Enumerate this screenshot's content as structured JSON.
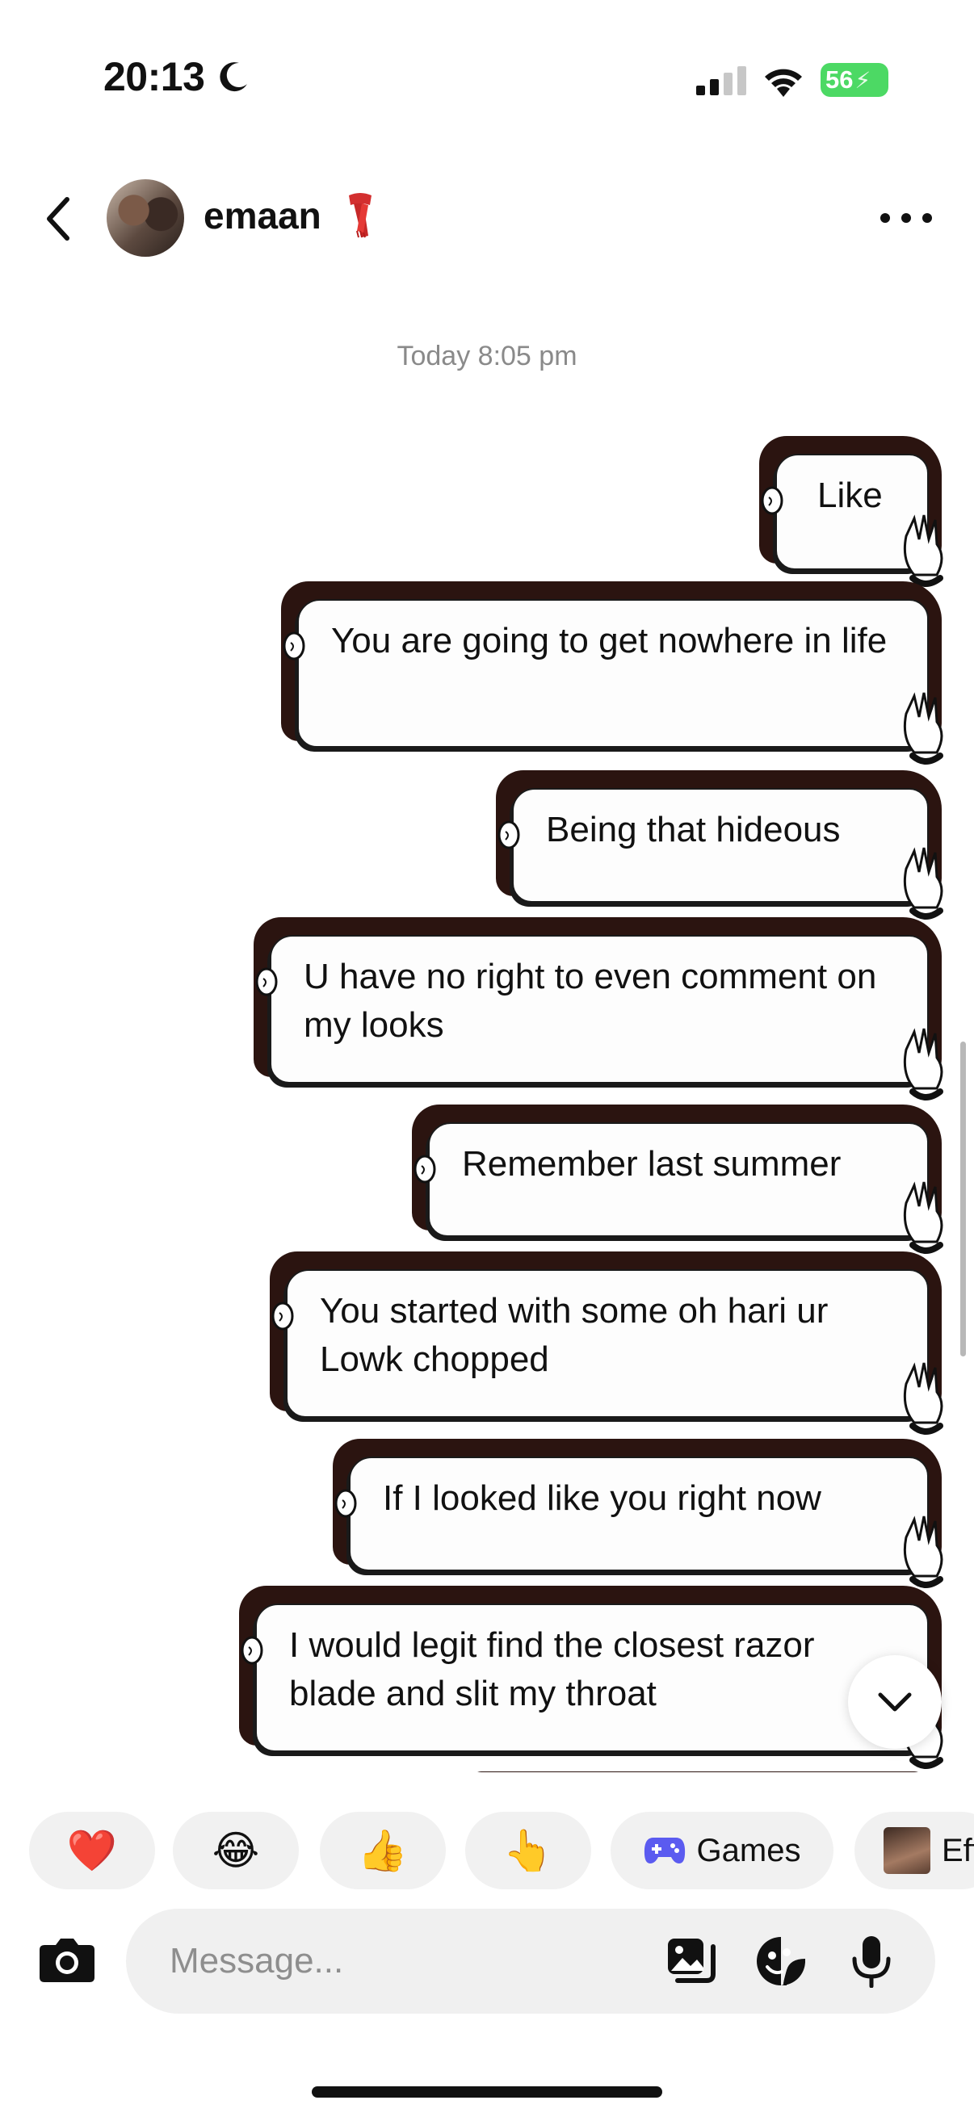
{
  "status_bar": {
    "time": "20:13",
    "battery": "56"
  },
  "header": {
    "contact_name": "emaan"
  },
  "timestamp": "Today 8:05 pm",
  "messages": [
    {
      "text": "Like"
    },
    {
      "text": "You are going to get nowhere in life"
    },
    {
      "text": "Being that hideous"
    },
    {
      "text": "U have no right to even comment on my looks"
    },
    {
      "text": "Remember last summer"
    },
    {
      "text": "You started with some oh hari ur Lowk chopped"
    },
    {
      "text": "If I looked like you right now"
    },
    {
      "text": "I would legit find the closest razor blade and slit my throat"
    }
  ],
  "quick_reactions": [
    {
      "emoji": "❤️",
      "icon": "red-heart-icon"
    },
    {
      "emoji": "😂",
      "icon": "laughing-face-icon"
    },
    {
      "emoji": "👍",
      "icon": "thumbs-up-icon"
    },
    {
      "emoji": "👆",
      "icon": "pointing-up-icon"
    },
    {
      "label": "Games",
      "icon": "game-controller-icon"
    },
    {
      "label": "Eff",
      "icon": "effects-avatar-icon"
    }
  ],
  "composer": {
    "placeholder": "Message..."
  },
  "colors": {
    "bubble_theme_dark": "#2b1410",
    "battery_green": "#4cd964",
    "chip_bg": "#f1f1f1",
    "games_blue": "#5b5bf0"
  }
}
